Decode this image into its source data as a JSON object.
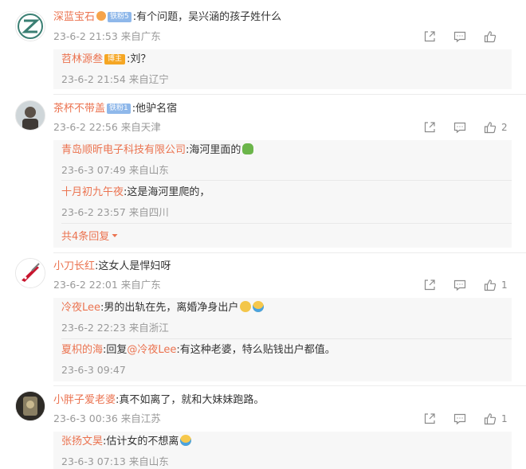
{
  "comments": [
    {
      "user": "深蓝宝石",
      "fan_badge": "铁粉5",
      "text": ":有个问题，吴兴涵的孩子姓什么",
      "meta": "23-6-2 21:53 来自广东",
      "likes": "",
      "replies": [
        {
          "user": "苕林源叁",
          "badge": "博主",
          "text": ":刘？",
          "meta": "23-6-2 21:54 来自辽宁"
        }
      ]
    },
    {
      "user": "茶杯不带盖",
      "fan_badge": "铁粉1",
      "text": ":他驴名宿",
      "meta": "23-6-2 22:56 来自天津",
      "likes": "2",
      "replies": [
        {
          "user": "青岛顺昕电子科技有限公司",
          "text": ":海河里面的",
          "meta": "23-6-3 07:49 来自山东"
        },
        {
          "user": "十月初九午夜",
          "text": ":这是海河里爬的，",
          "meta": "23-6-2 23:57 来自四川"
        }
      ],
      "more_label": "共4条回复"
    },
    {
      "user": "小刀长红",
      "text": ":这女人是悍妇呀",
      "meta": "23-6-2 22:01 来自广东",
      "likes": "1",
      "replies": [
        {
          "user": "冷夜Lee",
          "text": ":男的出轨在先，离婚净身出户",
          "meta": "23-6-2 22:23 来自浙江"
        },
        {
          "user": "夏枳的海",
          "prefix": ":回复",
          "mention": "@冷夜Lee",
          "text": ":有这种老婆，特么贴钱出户都值。",
          "meta": "23-6-3 09:47"
        }
      ]
    },
    {
      "user": "小胖子爱老婆",
      "text": ":真不如离了，就和大妹妹跑路。",
      "meta": "23-6-3 00:36 来自江苏",
      "likes": "1",
      "replies": [
        {
          "user": "张扬文昊",
          "text": ":估计女的不想离",
          "meta": "23-6-3 07:13 来自山东"
        }
      ]
    }
  ],
  "colors": {
    "username": "#eb7350",
    "meta": "#999999",
    "reply_bg": "#f7f7f7",
    "badge_fan": "#8fb8ea",
    "badge_host": "#f5a623"
  },
  "icons": [
    "share-icon",
    "comment-icon",
    "like-icon",
    "arrow-down-icon",
    "turtle-emoji",
    "cat-emoji",
    "laugh-emoji"
  ]
}
